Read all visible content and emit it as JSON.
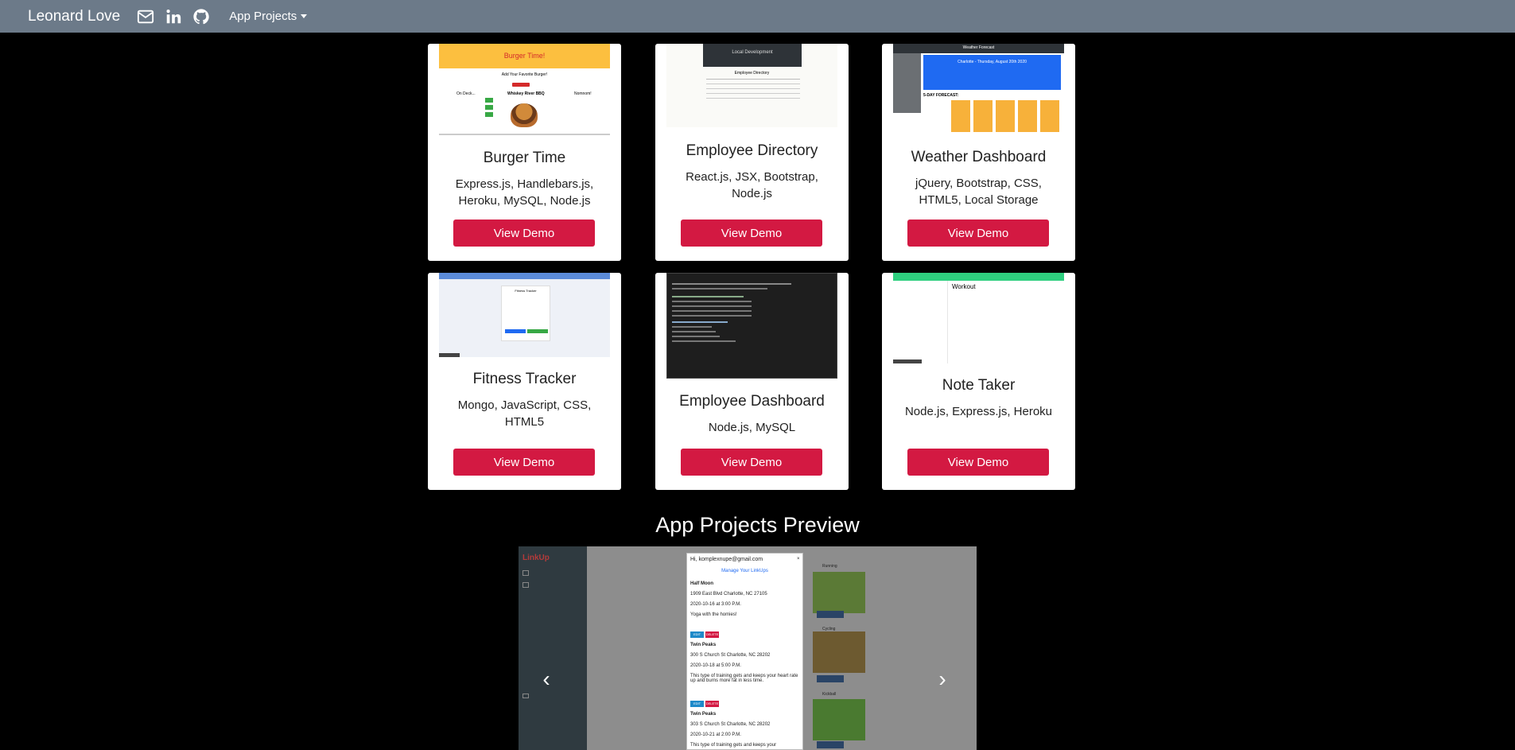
{
  "navbar": {
    "brand": "Leonard Love",
    "icons": [
      "mail-icon",
      "linkedin-icon",
      "github-icon"
    ],
    "dropdown_label": "App Projects",
    "background": "#6c7a89"
  },
  "projects": [
    {
      "title": "Burger Time",
      "tech": "Express.js, Handlebars.js, Heroku, MySQL, Node.js",
      "button": "View Demo",
      "thumb_text": {
        "header": "Burger Time!",
        "prompt": "Add Your Favorite Burger!",
        "left": "On Deck...",
        "middle": "Whiskey River BBQ",
        "right": "Nomnom!"
      }
    },
    {
      "title": "Employee Directory",
      "tech": "React.js, JSX, Bootstrap, Node.js",
      "button": "View Demo",
      "thumb_text": {
        "header": "Local Development",
        "subheader": "Employee Directory"
      }
    },
    {
      "title": "Weather Dashboard",
      "tech": "jQuery, Bootstrap, CSS, HTML5, Local Storage",
      "button": "View Demo",
      "thumb_text": {
        "header": "Weather Forecast",
        "city": "Charlotte - Thursday, August 20th 2020",
        "forecast": "5-DAY FORECAST:"
      }
    },
    {
      "title": "Fitness Tracker",
      "tech": "Mongo, JavaScript, CSS, HTML5",
      "button": "View Demo",
      "thumb_text": {
        "header": "Fitness Tracker"
      }
    },
    {
      "title": "Employee Dashboard",
      "tech": "Node.js, MySQL",
      "button": "View Demo",
      "thumb_text": {}
    },
    {
      "title": "Note Taker",
      "tech": "Node.js, Express.js, Heroku",
      "button": "View Demo",
      "thumb_text": {
        "note": "Workout"
      }
    }
  ],
  "accent_color": "#d31942",
  "preview": {
    "title": "App Projects Preview",
    "app_logo": "LinkUp",
    "modal": {
      "greeting": "Hi, komplexnupe@gmail.com",
      "manage_link": "Manage Your LinkUps",
      "entries": [
        {
          "name": "Half Moon",
          "where": "1909 East Blvd Charlotte, NC 27105",
          "when": "2020-10-16 at 3:00 P.M.",
          "what": "Yoga with the homies!"
        },
        {
          "name": "Twin Peaks",
          "where": "300 S Church St Charlotte, NC 28202",
          "when": "2020-10-18 at 5:00 P.M.",
          "what": "This type of training gets and keeps your heart rate up and burns more fat in less time."
        },
        {
          "name": "Twin Peaks",
          "where": "303 S Church St Charlotte, NC 28202",
          "when": "2020-10-21 at 2:00 P.M.",
          "what": "This type of training gets and keeps your"
        }
      ],
      "edit_label": "EDIT",
      "delete_label": "DELETE"
    },
    "tiles": [
      {
        "label": "Running",
        "button": "VIEW LINKUPS"
      },
      {
        "label": "Cycling",
        "button": "VIEW LINKUPS"
      },
      {
        "label": "Kickball",
        "button": "VIEW LINKUPS"
      }
    ],
    "prev_label": "‹",
    "next_label": "›"
  }
}
